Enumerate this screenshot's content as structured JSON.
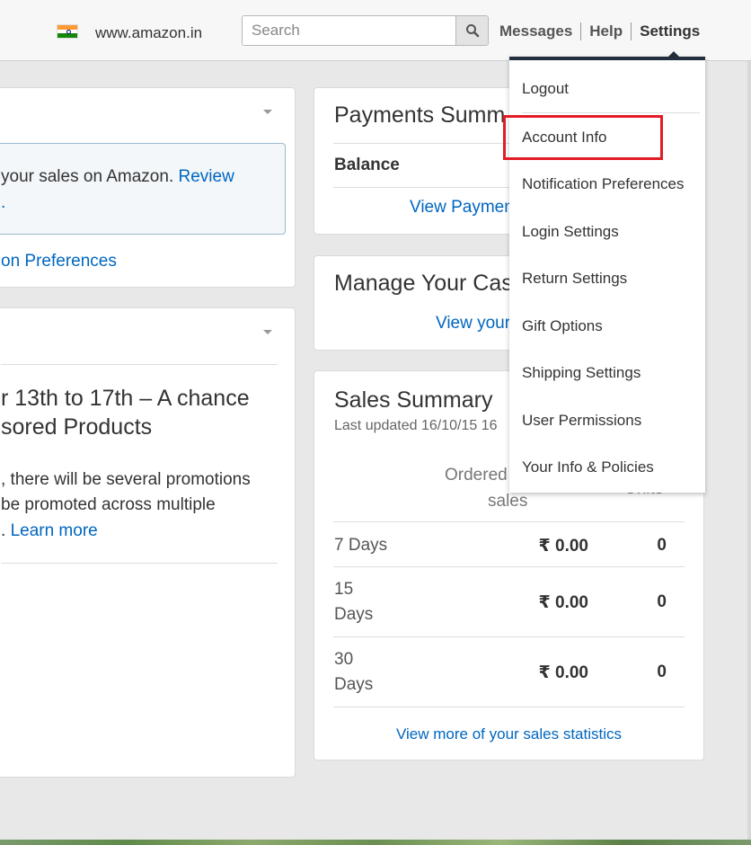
{
  "header": {
    "marketplace_flag": "india-flag-icon",
    "site_name": "www.amazon.in",
    "search_placeholder": "Search",
    "nav": {
      "messages": "Messages",
      "help": "Help",
      "settings": "Settings"
    }
  },
  "notifications_card": {
    "text_line1": "your sales on Amazon.",
    "link_review": "Review",
    "text_line2": ".",
    "link_preferences": "on Preferences"
  },
  "news_card": {
    "headline_line1": "r 13th to 17th – A chance",
    "headline_line2": "sored Products",
    "body_line1": ", there will be several promotions",
    "body_line2": "be promoted across multiple",
    "body_line3_prefix": ".",
    "link_learn_more": "Learn more"
  },
  "payments_card": {
    "title": "Payments Summ",
    "balance_label": "Balance",
    "link": "View Paymen"
  },
  "cases_card": {
    "title": "Manage Your Cas",
    "link": "View your"
  },
  "sales_card": {
    "title": "Sales Summary",
    "updated": "Last updated 16/10/15 16",
    "col_ordered_line1": "Ordered",
    "col_ordered_line2": "sales",
    "col_units": "Units",
    "rows": [
      {
        "period_line1": "7 Days",
        "period_line2": "",
        "sales": "₹ 0.00",
        "units": "0"
      },
      {
        "period_line1": "15",
        "period_line2": "Days",
        "sales": "₹ 0.00",
        "units": "0"
      },
      {
        "period_line1": "30",
        "period_line2": "Days",
        "sales": "₹ 0.00",
        "units": "0"
      }
    ],
    "more_link": "View more of your sales statistics"
  },
  "settings_menu": {
    "items": [
      "Logout",
      "Account Info",
      "Notification Preferences",
      "Login Settings",
      "Return Settings",
      "Gift Options",
      "Shipping Settings",
      "User Permissions",
      "Your Info & Policies"
    ],
    "highlighted_item": "Account Info",
    "highlight_color": "#e21b25"
  },
  "colors": {
    "link": "#0066c0",
    "menu_top_border": "#232f3e",
    "notice_background": "#f3f7fa"
  }
}
